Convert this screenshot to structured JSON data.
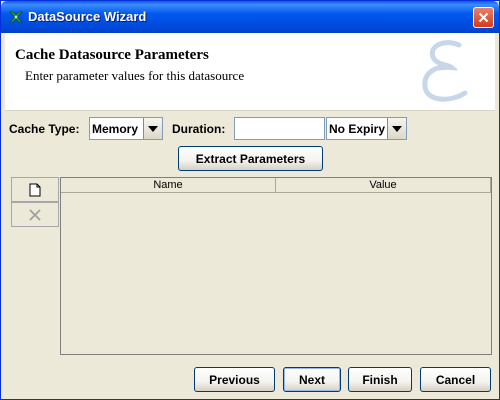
{
  "window": {
    "title": "DataSource Wizard"
  },
  "header": {
    "title": "Cache Datasource Parameters",
    "subtitle": "Enter parameter values for this datasource",
    "logo_icon": "script-e-logo-icon"
  },
  "form": {
    "cache_type_label": "Cache Type:",
    "cache_type_value": "Memory",
    "duration_label": "Duration:",
    "duration_value": "",
    "expiry_value": "No Expiry",
    "extract_button": "Extract Parameters"
  },
  "table": {
    "columns": [
      "Name",
      "Value"
    ],
    "rows": [],
    "add_icon": "new-document-icon",
    "delete_icon": "delete-x-icon"
  },
  "footer": {
    "previous": "Previous",
    "next": "Next",
    "finish": "Finish",
    "cancel": "Cancel"
  },
  "colors": {
    "titlebar": "#0054e3",
    "window_bg": "#ece9d8",
    "close_button": "#d33a1b"
  }
}
